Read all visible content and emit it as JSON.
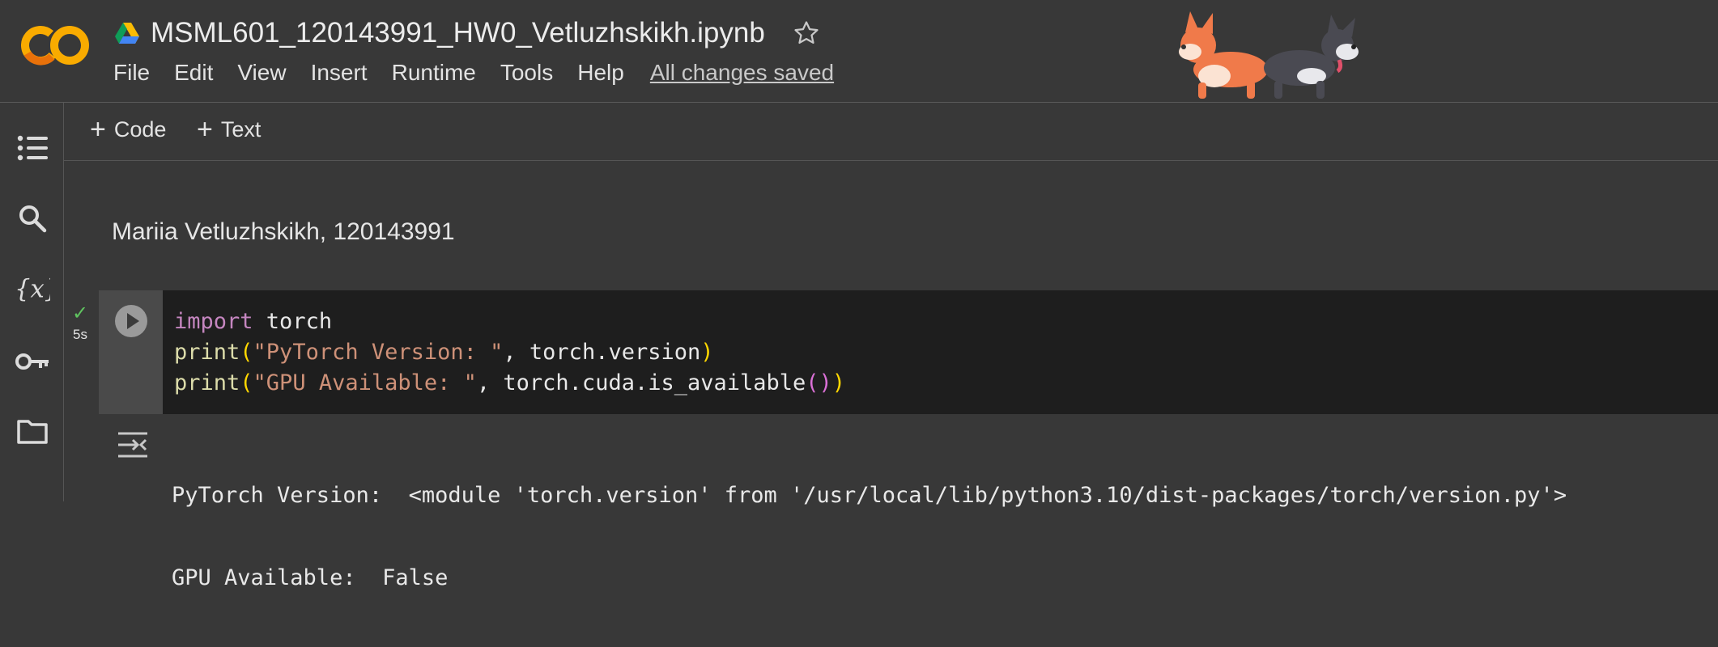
{
  "notebook": {
    "title": "MSML601_120143991_HW0_Vetluzhskikh.ipynb",
    "save_status": "All changes saved"
  },
  "menu": [
    "File",
    "Edit",
    "View",
    "Insert",
    "Runtime",
    "Tools",
    "Help"
  ],
  "toolbar": {
    "add_code": "Code",
    "add_text": "Text"
  },
  "text_cell": {
    "content": "Mariia Vetluzhskikh, 120143991"
  },
  "code_cell": {
    "exec_time": "5s",
    "lines": [
      [
        {
          "t": "import",
          "c": "kw"
        },
        {
          "t": " torch",
          "c": ""
        }
      ],
      [
        {
          "t": "print",
          "c": "fn"
        },
        {
          "t": "(",
          "c": "p1"
        },
        {
          "t": "\"PyTorch Version: \"",
          "c": "str"
        },
        {
          "t": ", torch.version",
          "c": ""
        },
        {
          "t": ")",
          "c": "p1"
        }
      ],
      [
        {
          "t": "print",
          "c": "fn"
        },
        {
          "t": "(",
          "c": "p1"
        },
        {
          "t": "\"GPU Available: \"",
          "c": "str"
        },
        {
          "t": ", torch.cuda.is_available",
          "c": ""
        },
        {
          "t": "()",
          "c": "p2"
        },
        {
          "t": ")",
          "c": "p1"
        }
      ]
    ]
  },
  "output": {
    "lines": [
      "PyTorch Version:  <module 'torch.version' from '/usr/local/lib/python3.10/dist-packages/torch/version.py'>",
      "GPU Available:  False"
    ]
  },
  "icons": {
    "logo": "colab-logo",
    "drive": "google-drive-icon",
    "star": "star-icon",
    "rail": [
      "table-of-contents-icon",
      "search-icon",
      "variables-icon",
      "secrets-key-icon",
      "folder-icon"
    ],
    "output": "output-actions-icon"
  },
  "colors": {
    "background": "#383838",
    "code_background": "#1e1e1e",
    "logo_orange": "#f9ab00",
    "logo_dark_orange": "#e8710a",
    "check_green": "#5fc35f"
  }
}
